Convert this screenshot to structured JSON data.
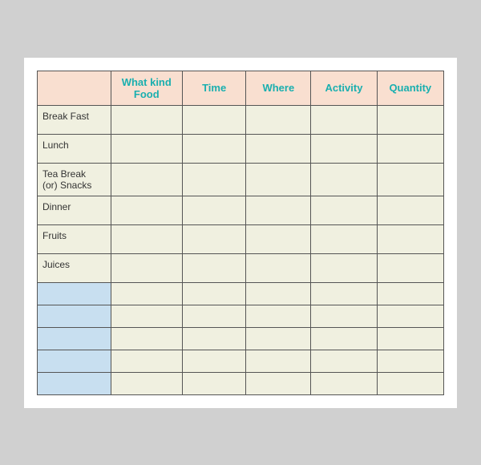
{
  "table": {
    "headers": [
      "",
      "What kind\nFood",
      "Time",
      "Where",
      "Activity",
      "Quantity"
    ],
    "rows": [
      {
        "label": "Break Fast",
        "cells": [
          "",
          "",
          "",
          "",
          ""
        ]
      },
      {
        "label": "Lunch",
        "cells": [
          "",
          "",
          "",
          "",
          ""
        ]
      },
      {
        "label": "Tea Break\n(or) Snacks",
        "cells": [
          "",
          "",
          "",
          "",
          ""
        ]
      },
      {
        "label": "Dinner",
        "cells": [
          "",
          "",
          "",
          "",
          ""
        ]
      },
      {
        "label": "Fruits",
        "cells": [
          "",
          "",
          "",
          "",
          ""
        ]
      },
      {
        "label": "Juices",
        "cells": [
          "",
          "",
          "",
          "",
          ""
        ]
      },
      {
        "label": "",
        "cells": [
          "",
          "",
          "",
          "",
          ""
        ],
        "blue": true
      },
      {
        "label": "",
        "cells": [
          "",
          "",
          "",
          "",
          ""
        ],
        "blue": true
      },
      {
        "label": "",
        "cells": [
          "",
          "",
          "",
          "",
          ""
        ],
        "blue": true
      },
      {
        "label": "",
        "cells": [
          "",
          "",
          "",
          "",
          ""
        ],
        "blue": true
      },
      {
        "label": "",
        "cells": [
          "",
          "",
          "",
          "",
          ""
        ],
        "blue": true
      }
    ]
  }
}
